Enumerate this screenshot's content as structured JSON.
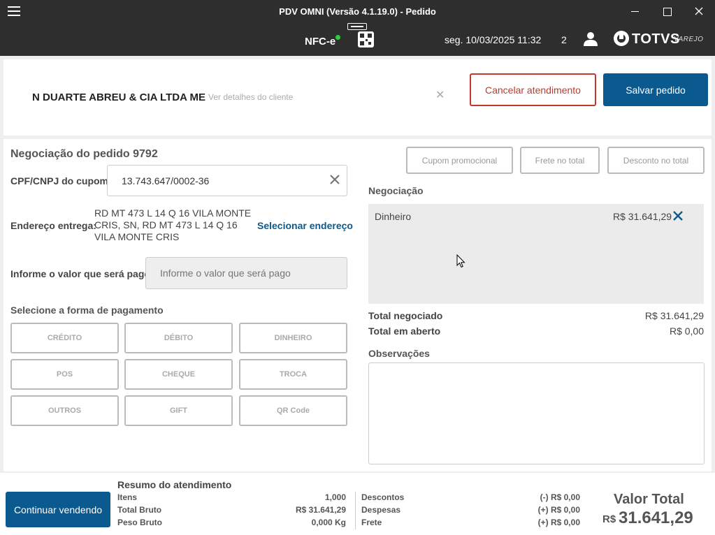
{
  "window": {
    "title": "PDV OMNI (Versão 4.1.19.0) - Pedido"
  },
  "header": {
    "nfce_label": "NFC-e",
    "datetime": "seg. 10/03/2025 11:32",
    "counter": "2",
    "logo_text": "TOTVS",
    "logo_sub": "VAREJO"
  },
  "client": {
    "name": "N DUARTE ABREU & CIA LTDA ME",
    "details_link": "Ver detalhes do cliente",
    "cancel_label": "Cancelar atendimento",
    "save_label": "Salvar pedido"
  },
  "order": {
    "title": "Negociação do pedido 9792",
    "cpf_label": "CPF/CNPJ do cupom",
    "cpf_value": "13.743.647/0002-36",
    "address_label": "Endereço entrega:",
    "address_value": "RD MT 473 L 14 Q 16 VILA MONTE CRIS, SN, RD MT 473 L 14 Q 16 VILA MONTE CRIS",
    "select_address": "Selecionar endereço",
    "pay_value_label": "Informe o valor que será pago",
    "pay_value_placeholder": "Informe o valor que será pago",
    "payment_form_label": "Selecione a forma de pagamento",
    "payment_methods": [
      "CRÉDITO",
      "DÉBITO",
      "DINHEIRO",
      "POS",
      "CHEQUE",
      "TROCA",
      "OUTROS",
      "GIFT",
      "QR Code"
    ]
  },
  "negotiation": {
    "promo_button": "Cupom promocional",
    "freight_button": "Frete no total",
    "discount_button": "Desconto no total",
    "label": "Negociação",
    "items": [
      {
        "method": "Dinheiro",
        "amount": "R$ 31.641,29"
      }
    ],
    "total_negotiated_label": "Total negociado",
    "total_negotiated": "R$ 31.641,29",
    "total_open_label": "Total em aberto",
    "total_open": "R$ 0,00",
    "observations_label": "Observações"
  },
  "summary": {
    "continue_label": "Continuar vendendo",
    "title": "Resumo do atendimento",
    "items_label": "Itens",
    "items_value": "1,000",
    "gross_total_label": "Total Bruto",
    "gross_total_value": "R$ 31.641,29",
    "gross_weight_label": "Peso Bruto",
    "gross_weight_value": "0,000 Kg",
    "discounts_label": "Descontos",
    "discounts_value": "(-) R$ 0,00",
    "expenses_label": "Despesas",
    "expenses_value": "(+) R$ 0,00",
    "freight_label": "Frete",
    "freight_value": "(+) R$ 0,00",
    "total_label": "Valor Total",
    "total_currency": "R$",
    "total_value": "31.641,29"
  }
}
